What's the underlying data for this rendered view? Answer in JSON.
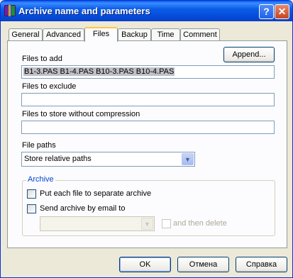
{
  "window": {
    "title": "Archive name and parameters",
    "help_label": "?",
    "close_label": "✕"
  },
  "tabs": [
    {
      "label": "General"
    },
    {
      "label": "Advanced"
    },
    {
      "label": "Files"
    },
    {
      "label": "Backup"
    },
    {
      "label": "Time"
    },
    {
      "label": "Comment"
    }
  ],
  "active_tab": "Files",
  "files": {
    "files_to_add_label": "Files to add",
    "files_to_add_value": "B1-3.PAS B1-4.PAS B10-3.PAS B10-4.PAS",
    "append_label": "Append...",
    "files_to_exclude_label": "Files to exclude",
    "files_to_exclude_value": "",
    "files_no_compression_label": "Files to store without compression",
    "files_no_compression_value": "",
    "file_paths_label": "File paths",
    "file_paths_value": "Store relative paths"
  },
  "archive_group": {
    "title": "Archive",
    "separate_archive_label": "Put each file to separate archive",
    "separate_archive_checked": false,
    "send_email_label": "Send archive by email to",
    "send_email_checked": false,
    "email_value": "",
    "then_delete_label": "and then delete",
    "then_delete_checked": false
  },
  "footer": {
    "ok_label": "OK",
    "cancel_label": "Отмена",
    "help_label": "Справка"
  },
  "colors": {
    "titlebar": "#0A58E8",
    "face": "#ECE9D8",
    "group_title": "#0046D5",
    "active_tab_accent": "#FFC83C"
  }
}
